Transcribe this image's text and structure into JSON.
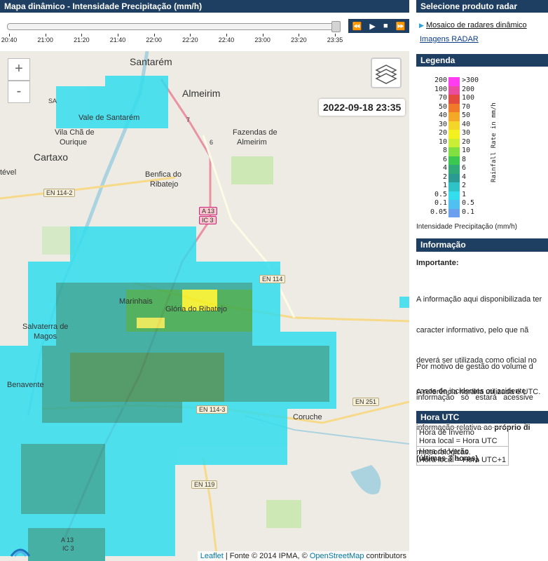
{
  "header": {
    "title": "Mapa dinâmico - Intensidade Precipitação (mm/h)"
  },
  "timeline": {
    "labels": [
      "20:40",
      "21:00",
      "21:20",
      "21:40",
      "22:00",
      "22:20",
      "22:40",
      "23:00",
      "23:20",
      "23:35"
    ],
    "controls": {
      "rewind": "⏪",
      "play": "▶",
      "stop": "■",
      "forward": "⏩"
    }
  },
  "map": {
    "zoom_in": "+",
    "zoom_out": "-",
    "timestamp": "2022-09-18 23:35",
    "places": {
      "santarem": "Santarém",
      "almeirim": "Almeirim",
      "vale_santarem": "Vale de Santarém",
      "vila_cha": "Vila Chã de",
      "ourique": "Ourique",
      "cartaxo": "Cartaxo",
      "fazendas": "Fazendas de",
      "almeirim2": "Almeirim",
      "benfica": "Benfica do",
      "ribatejo": "Ribatejo",
      "tevel": "tével",
      "marinhais": "Marinhais",
      "gloria": "Glória do Ribatejo",
      "salvaterra": "Salvaterra de",
      "magos": "Magos",
      "benavente": "Benavente",
      "coruche": "Coruche"
    },
    "roads": {
      "en114_2": "EN 114-2",
      "a13": "A 13",
      "ic3": "IC 3",
      "en114": "EN 114",
      "en114_3": "EN 114-3",
      "en251": "EN 251",
      "en119": "EN 119",
      "a13b": "A 13",
      "ic3b": "IC 3",
      "sa": "SA",
      "n7": "7",
      "n6": "6"
    },
    "attribution": {
      "leaflet": "Leaflet",
      "text": " | Fonte © 2014 IPMA, © ",
      "osm": "OpenStreetMap",
      "tail": " contributors"
    }
  },
  "sidebar": {
    "product_title": "Selecione produto radar",
    "product_links": [
      "Mosaico de radares dinâmico",
      "Imagens RADAR"
    ],
    "legend_title": "Legenda",
    "legend_left": [
      "200",
      "100",
      "70",
      "50",
      "40",
      "30",
      "20",
      "10",
      "8",
      "6",
      "4",
      "2",
      "1",
      "0.5",
      "0.1",
      "0.05"
    ],
    "legend_right": [
      ">300",
      "200",
      "100",
      "70",
      "50",
      "40",
      "30",
      "20",
      "10",
      "8",
      "6",
      "4",
      "2",
      "1",
      "0.5",
      "0.1"
    ],
    "legend_axis": "Rainfall Rate in mm/h",
    "legend_caption": "Intensidade Precipitação (mm/h)",
    "info_title": "Informação",
    "info_important": "Importante:",
    "info_p1": [
      "A informação aqui disponibilizada ter",
      "caracter informativo, pelo que nã",
      "deverá ser utilizada como oficial no",
      "casos de incidentes ou acidente",
      "relacionados         com     condiçõe",
      "meteorológicas."
    ],
    "info_p2a": [
      "Por motivo de gestão do volume d",
      "informação   só   estará   acessive"
    ],
    "info_p2b": "informação relativa ao ",
    "info_p2b_bold": "próprio di",
    "info_p2c": "(últimas 3 horas)",
    "info_p2c_end": ".",
    "info_p3": "A referência horária utilizada é UTC.",
    "utc_title": "Hora UTC",
    "utc_rows": [
      {
        "name": "Hora de Inverno",
        "rule": "Hora local = Hora UTC"
      },
      {
        "name": "Hora de Verão",
        "rule": "Hora local = Hora UTC+1"
      }
    ]
  },
  "colors": {
    "header": "#1f3f62",
    "rain_light": "#33ddee",
    "rain_mid": "#2aa69a",
    "rain_green": "#3aa84a",
    "rain_yellow": "#f4f020"
  }
}
